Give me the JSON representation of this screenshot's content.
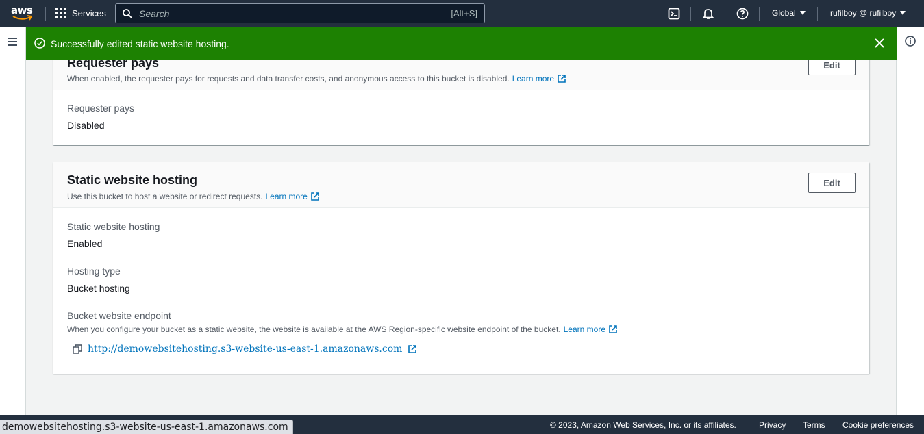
{
  "nav": {
    "logo_text": "aws",
    "services_label": "Services",
    "search_placeholder": "Search",
    "search_shortcut": "[Alt+S]",
    "region_label": "Global",
    "account_label": "rufilboy @ rufilboy"
  },
  "flash": {
    "message": "Successfully edited static website hosting."
  },
  "requester_pays": {
    "title": "Requester pays",
    "description": "When enabled, the requester pays for requests and data transfer costs, and anonymous access to this bucket is disabled.",
    "learn_more": "Learn more",
    "edit_label": "Edit",
    "field_label": "Requester pays",
    "field_value": "Disabled"
  },
  "static_hosting": {
    "title": "Static website hosting",
    "description": "Use this bucket to host a website or redirect requests.",
    "learn_more": "Learn more",
    "edit_label": "Edit",
    "status_label": "Static website hosting",
    "status_value": "Enabled",
    "type_label": "Hosting type",
    "type_value": "Bucket hosting",
    "endpoint_label": "Bucket website endpoint",
    "endpoint_description": "When you configure your bucket as a static website, the website is available at the AWS Region-specific website endpoint of the bucket.",
    "endpoint_learn_more": "Learn more",
    "endpoint_url": "http://demowebsitehosting.s3-website-us-east-1.amazonaws.com"
  },
  "footer": {
    "copyright": "© 2023, Amazon Web Services, Inc. or its affiliates.",
    "privacy": "Privacy",
    "terms": "Terms",
    "cookies": "Cookie preferences"
  },
  "browser_status": "demowebsitehosting.s3-website-us-east-1.amazonaws.com",
  "colors": {
    "nav_bg": "#232f3e",
    "flash_success": "#1d8102",
    "link": "#0073bb"
  }
}
